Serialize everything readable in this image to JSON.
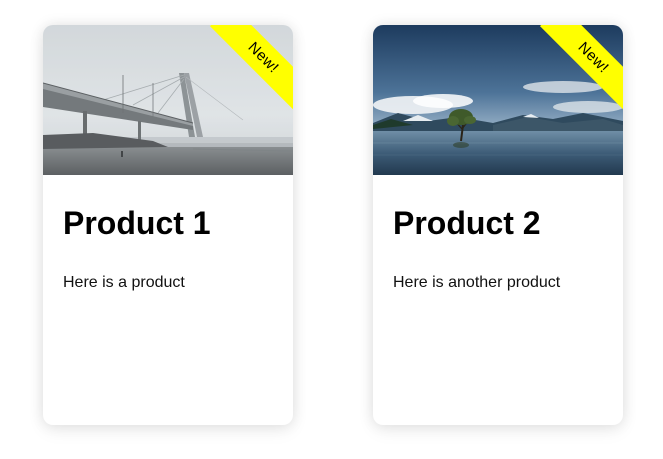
{
  "products": [
    {
      "badge": "New!",
      "title": "Product 1",
      "description": "Here is a product",
      "image": "foggy-bridge-photo"
    },
    {
      "badge": "New!",
      "title": "Product 2",
      "description": "Here is another product",
      "image": "lake-tree-photo"
    }
  ],
  "colors": {
    "badge_background": "#ffff00",
    "card_background": "#ffffff",
    "text": "#000000"
  }
}
